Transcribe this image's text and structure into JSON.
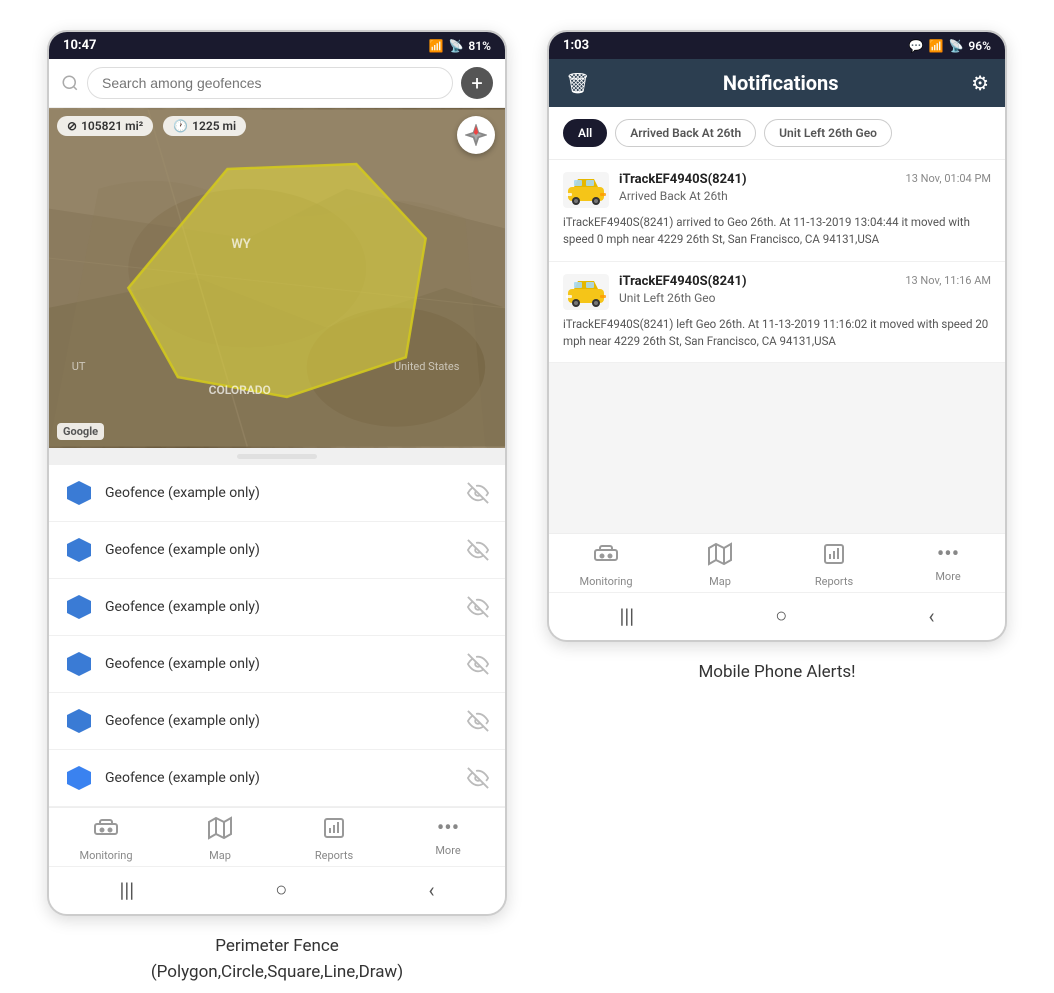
{
  "left_phone": {
    "status_bar": {
      "time": "10:47",
      "wifi": "WiFi",
      "signal": "Signal",
      "battery": "81%"
    },
    "search": {
      "placeholder": "Search among geofences"
    },
    "map": {
      "stat1": "105821 mi²",
      "stat2": "1225 mi",
      "label_wy": "WY",
      "label_us": "United States",
      "label_co": "COLORADO",
      "label_ut": "UT",
      "google": "Google"
    },
    "geofences": [
      {
        "name": "Geofence (example only)"
      },
      {
        "name": "Geofence (example only)"
      },
      {
        "name": "Geofence (example only)"
      },
      {
        "name": "Geofence (example only)"
      },
      {
        "name": "Geofence (example only)"
      },
      {
        "name": "Geofence (example only)"
      }
    ],
    "bottom_nav": [
      {
        "label": "Monitoring",
        "icon": "🚌"
      },
      {
        "label": "Map",
        "icon": "🗺"
      },
      {
        "label": "Reports",
        "icon": "📊"
      },
      {
        "label": "More",
        "icon": "···"
      }
    ],
    "caption": "Perimeter Fence\n(Polygon,Circle,Square,Line,Draw)"
  },
  "right_phone": {
    "status_bar": {
      "time": "1:03",
      "chat": "💬",
      "wifi": "WiFi",
      "signal": "Signal",
      "battery": "96%"
    },
    "header": {
      "title": "Notifications",
      "delete_icon": "🗑",
      "settings_icon": "⚙"
    },
    "filters": [
      {
        "label": "All",
        "active": true
      },
      {
        "label": "Arrived Back At 26th",
        "active": false
      },
      {
        "label": "Unit Left 26th Geo",
        "active": false
      }
    ],
    "notifications": [
      {
        "device": "iTrackEF4940S(8241)",
        "timestamp": "13 Nov, 01:04 PM",
        "event": "Arrived Back At 26th",
        "body": "iTrackEF4940S(8241) arrived to Geo 26th.    At 11-13-2019 13:04:44 it moved with speed 0 mph near 4229 26th St, San Francisco, CA 94131,USA"
      },
      {
        "device": "iTrackEF4940S(8241)",
        "timestamp": "13 Nov, 11:16 AM",
        "event": "Unit Left 26th Geo",
        "body": "iTrackEF4940S(8241) left Geo 26th.    At 11-13-2019 11:16:02 it moved with speed 20 mph near 4229 26th St, San Francisco, CA 94131,USA"
      }
    ],
    "bottom_nav": [
      {
        "label": "Monitoring",
        "icon": "🚌"
      },
      {
        "label": "Map",
        "icon": "🗺"
      },
      {
        "label": "Reports",
        "icon": "📊"
      },
      {
        "label": "More",
        "icon": "···"
      }
    ],
    "caption": "Mobile Phone Alerts!"
  }
}
